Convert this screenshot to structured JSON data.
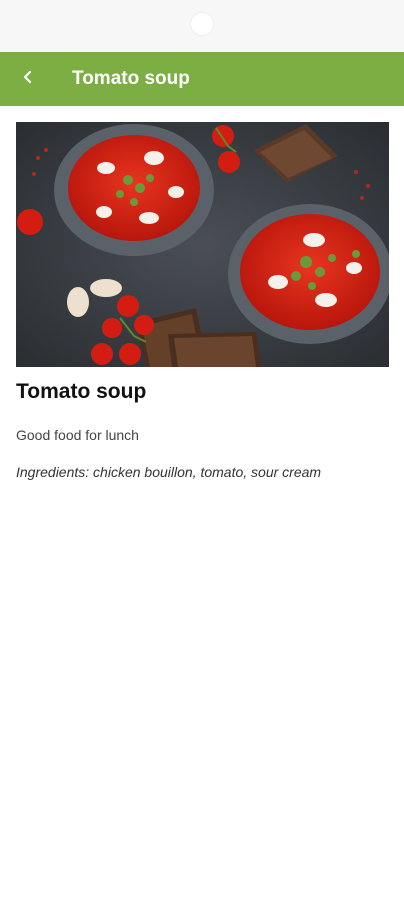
{
  "app_bar": {
    "title": "Tomato soup",
    "back_icon": "chevron-left-icon",
    "color": "#7cae43"
  },
  "recipe": {
    "image_alt": "Bowls of tomato soup with sour cream, herbs, cherry tomatoes, garlic and rye bread",
    "title": "Tomato soup",
    "description": "Good food for lunch",
    "ingredients": "Ingredients: chicken bouillon, tomato, sour cream"
  }
}
